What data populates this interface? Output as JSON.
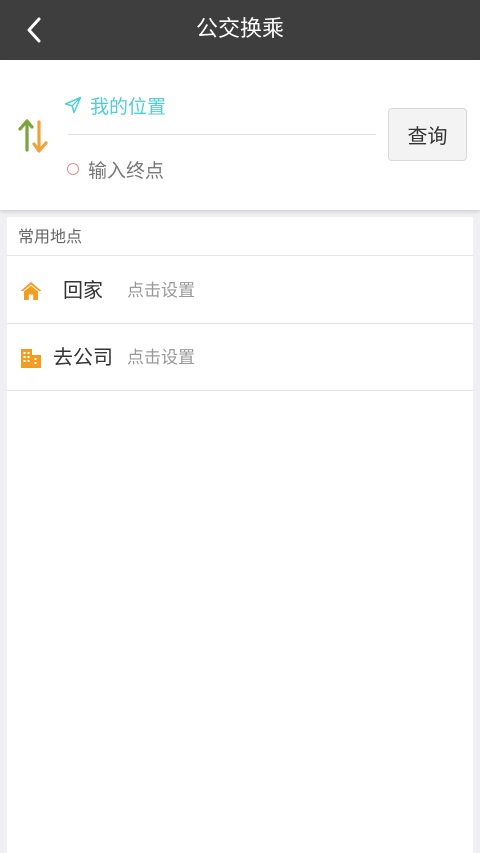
{
  "header": {
    "title": "公交换乘",
    "back_icon": "chevron-left-icon"
  },
  "route": {
    "origin_label": "我的位置",
    "origin_icon": "navigation-arrow-icon",
    "destination_placeholder": "输入终点",
    "destination_icon": "circle-dot-icon",
    "swap_icon": "swap-vertical-icon",
    "query_label": "查询"
  },
  "places": {
    "header": "常用地点",
    "items": [
      {
        "icon": "home-icon",
        "name": "回家",
        "hint": "点击设置"
      },
      {
        "icon": "building-icon",
        "name": "去公司",
        "hint": "点击设置"
      }
    ]
  },
  "colors": {
    "titlebar": "#3f3e3f",
    "accent_cyan": "#4fcfd6",
    "icon_orange": "#f39c1f",
    "swap_green": "#7aa33a",
    "dest_pink": "#f1888f"
  }
}
